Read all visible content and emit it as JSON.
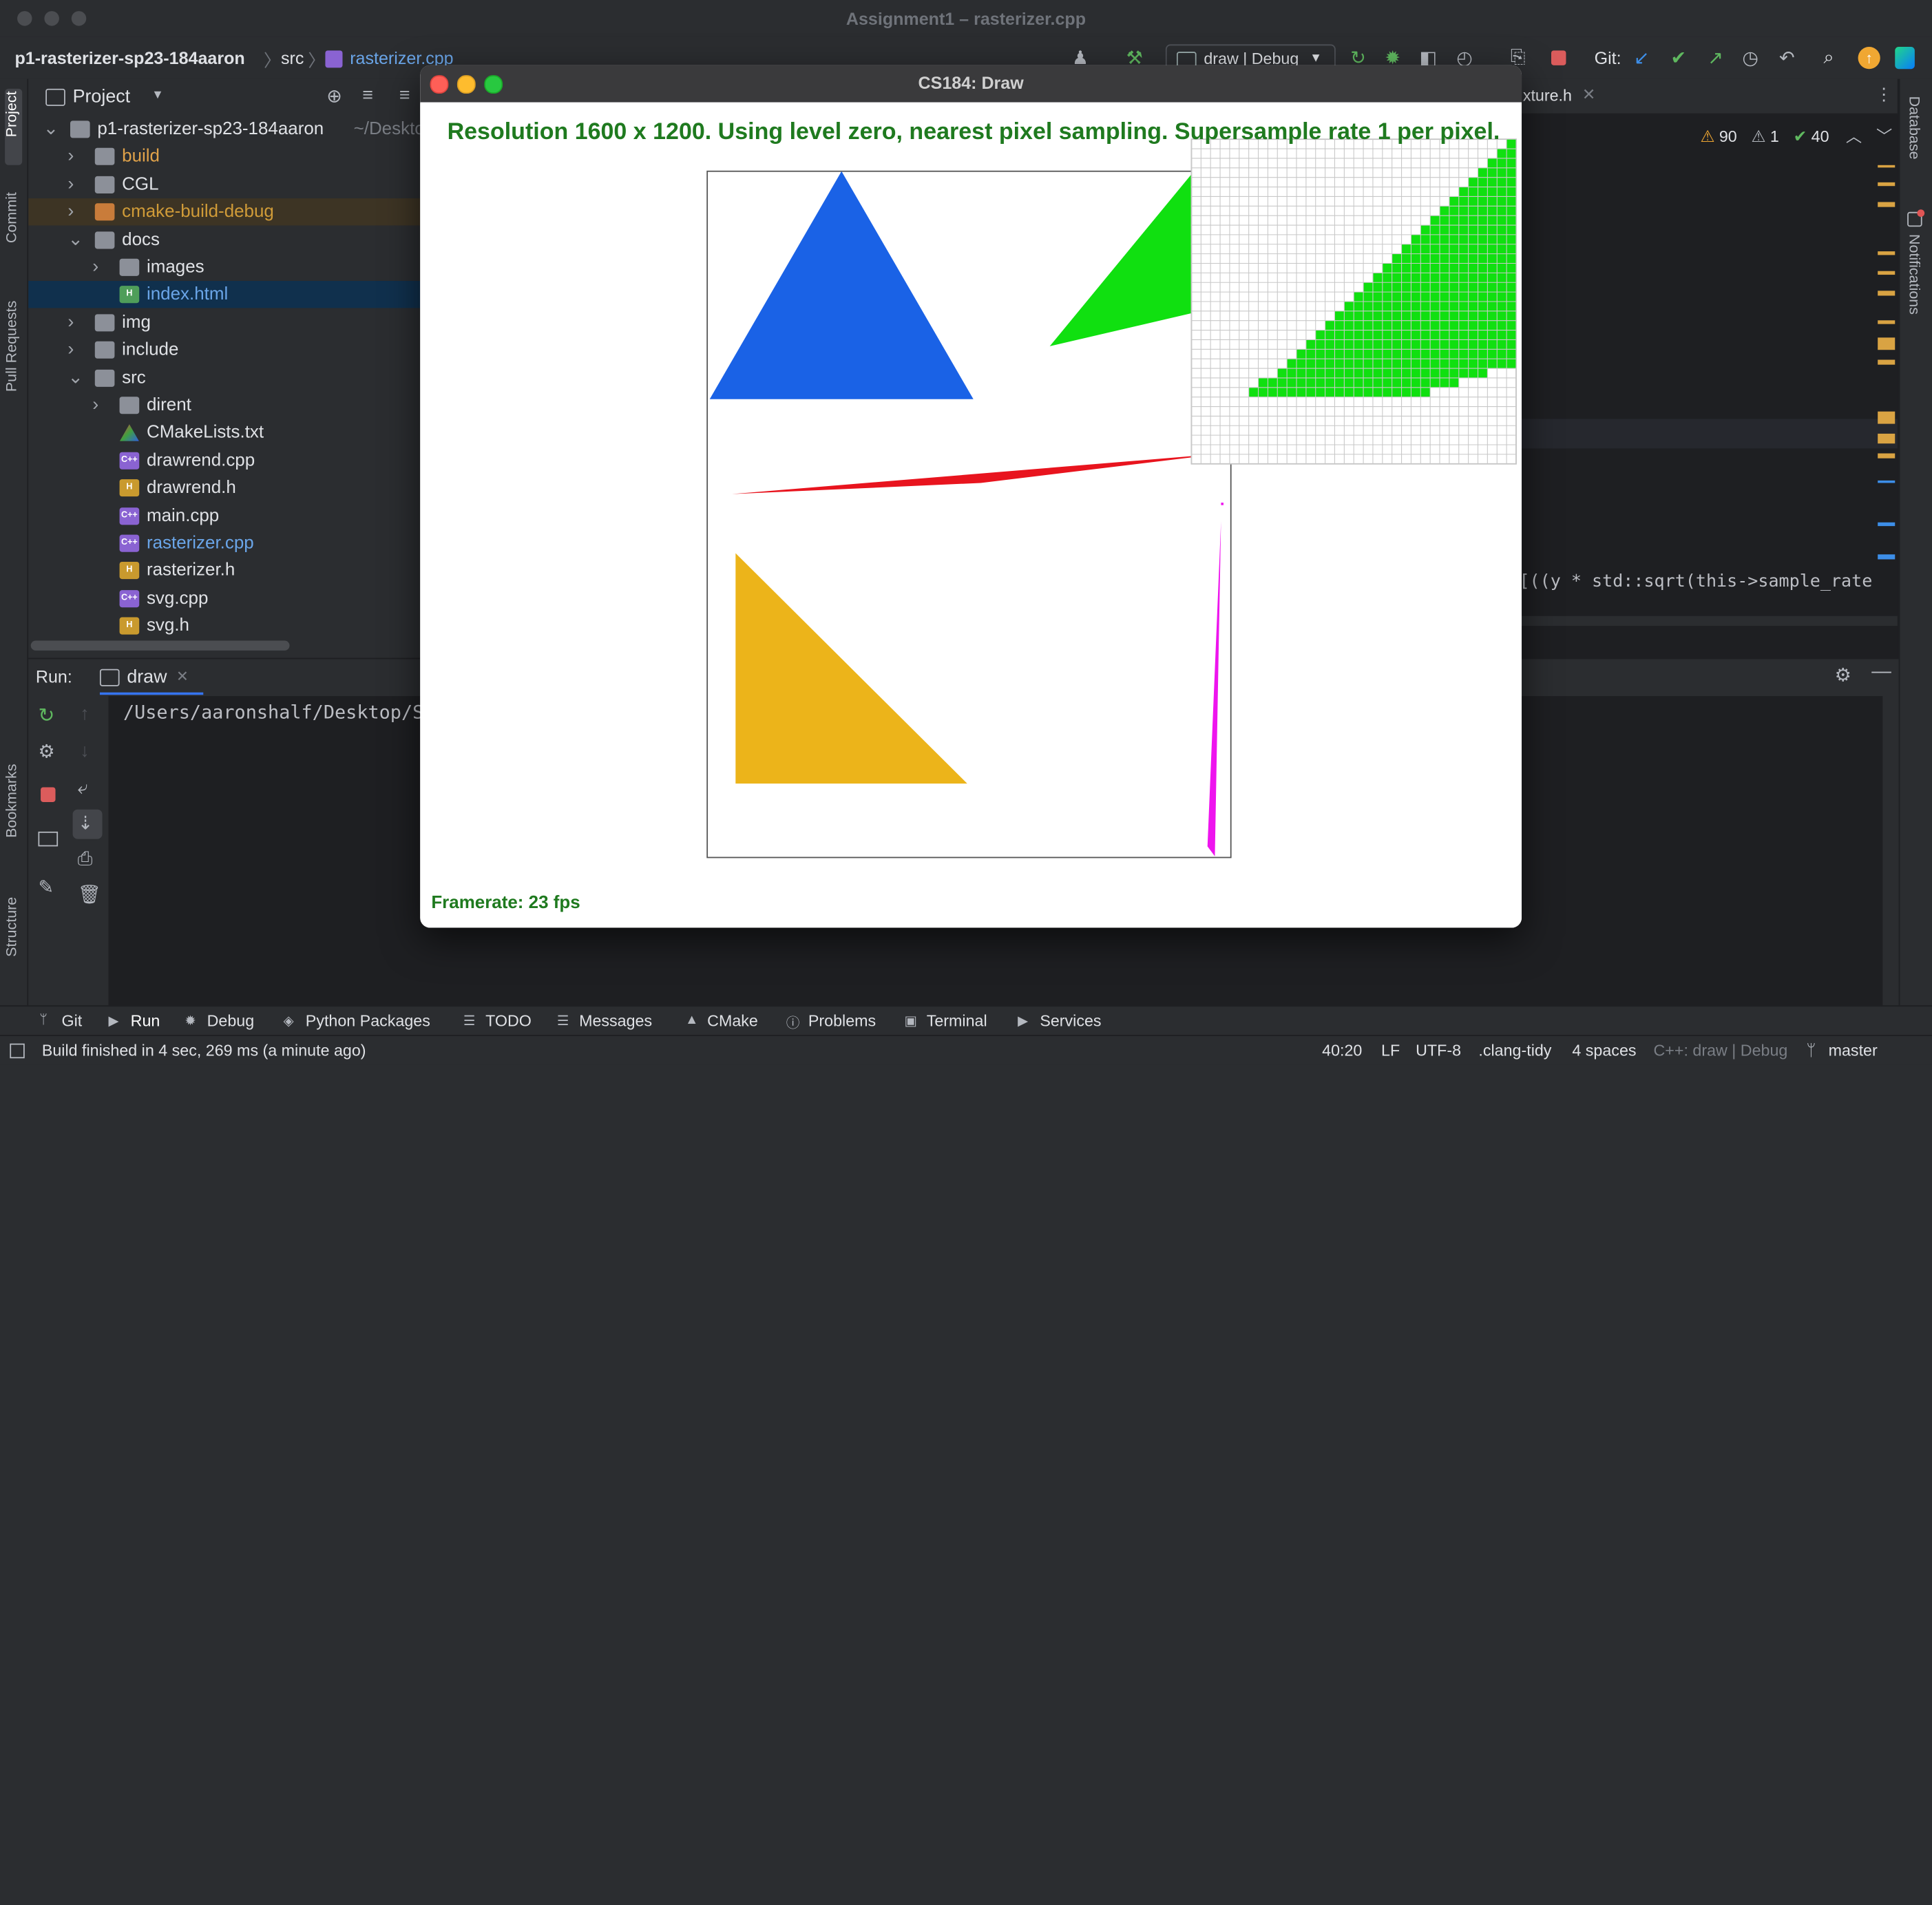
{
  "window": {
    "title": "Assignment1 – rasterizer.cpp"
  },
  "navbar": {
    "project": "p1-rasterizer-sp23-184aaron",
    "folder": "src",
    "file": "rasterizer.cpp",
    "run_config": "draw | Debug",
    "git_label": "Git:"
  },
  "left_strip": [
    "Project",
    "Commit",
    "Pull Requests",
    "Bookmarks",
    "Structure"
  ],
  "right_strip": [
    "Database",
    "Notifications"
  ],
  "project_panel": {
    "title": "Project",
    "tree": [
      {
        "depth": 0,
        "name": "p1-rasterizer-sp23-184aaron",
        "hint": "~/Desktop",
        "type": "folder",
        "open": true
      },
      {
        "depth": 1,
        "name": "build",
        "type": "folder",
        "color": "#e0a24a"
      },
      {
        "depth": 1,
        "name": "CGL",
        "type": "folder"
      },
      {
        "depth": 1,
        "name": "cmake-build-debug",
        "type": "folder-orange",
        "color": "#d09b38",
        "highlight": "#3d3424"
      },
      {
        "depth": 1,
        "name": "docs",
        "type": "folder",
        "open": true
      },
      {
        "depth": 2,
        "name": "images",
        "type": "folder"
      },
      {
        "depth": 2,
        "name": "index.html",
        "type": "html",
        "color": "#6aa5e8",
        "selected": true
      },
      {
        "depth": 1,
        "name": "img",
        "type": "folder"
      },
      {
        "depth": 1,
        "name": "include",
        "type": "folder"
      },
      {
        "depth": 1,
        "name": "src",
        "type": "folder",
        "open": true
      },
      {
        "depth": 2,
        "name": "dirent",
        "type": "folder"
      },
      {
        "depth": 2,
        "name": "CMakeLists.txt",
        "type": "cmake"
      },
      {
        "depth": 2,
        "name": "drawrend.cpp",
        "type": "cpp"
      },
      {
        "depth": 2,
        "name": "drawrend.h",
        "type": "h"
      },
      {
        "depth": 2,
        "name": "main.cpp",
        "type": "cpp"
      },
      {
        "depth": 2,
        "name": "rasterizer.cpp",
        "type": "cpp",
        "color": "#6aa5e8"
      },
      {
        "depth": 2,
        "name": "rasterizer.h",
        "type": "h"
      },
      {
        "depth": 2,
        "name": "svg.cpp",
        "type": "cpp"
      },
      {
        "depth": 2,
        "name": "svg.h",
        "type": "h"
      }
    ]
  },
  "editor": {
    "tab_fragment": "xture.h",
    "warnings": "90",
    "weak_warnings": "1",
    "ok_count": "40",
    "code_fragment": "[((y * std::sqrt(this->sample_rate"
  },
  "run_panel": {
    "label": "Run:",
    "tab": "draw",
    "console": "/Users/aaronshalf/Desktop/S"
  },
  "bottom_tabs": [
    "Git",
    "Run",
    "Debug",
    "Python Packages",
    "TODO",
    "Messages",
    "CMake",
    "Problems",
    "Terminal",
    "Services"
  ],
  "status": {
    "message": "Build finished in 4 sec, 269 ms (a minute ago)",
    "position": "40:20",
    "line_sep": "LF",
    "encoding": "UTF-8",
    "linter": ".clang-tidy",
    "indent": "4 spaces",
    "context": "C++: draw | Debug",
    "branch": "master"
  },
  "draw": {
    "title": "CS184: Draw",
    "info": "Resolution 1600 x 1200. Using level zero, nearest pixel sampling. Supersample rate 1 per pixel.",
    "framerate": "Framerate: 23 fps",
    "colors": {
      "blue": "#1a62e6",
      "green": "#10e010",
      "red": "#e8141e",
      "yellow": "#ecb41a",
      "magenta": "#ee14ee",
      "text": "#1f7a1f"
    }
  }
}
